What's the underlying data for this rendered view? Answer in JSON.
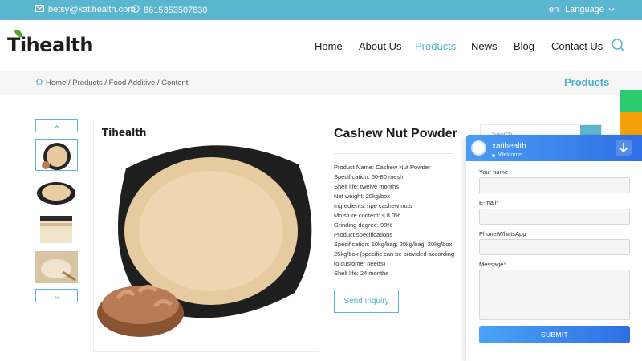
{
  "topbar": {
    "email": "betsy@xatihealth.com",
    "phone": "8615353507830",
    "lang_code": "en",
    "lang_label": "Language"
  },
  "header": {
    "logo": "Tihealth",
    "nav": [
      "Home",
      "About Us",
      "Products",
      "News",
      "Blog",
      "Contact Us"
    ],
    "active_nav": "Products"
  },
  "breadcrumb": {
    "path": "Home / Products / Food Additive / Content",
    "title": "Products"
  },
  "product": {
    "brand": "Tihealth",
    "title": "Cashew Nut Powder",
    "specs": [
      "Product Name: Cashew Nut Powder",
      "Specification: 60-80 mesh",
      "Shelf life: twelve months",
      "Net weight: 20kg/box",
      "Ingredients: ripe cashew nuts",
      "Moisture content: ≤ 8.0%",
      "Grinding degree: 98%",
      "Product specifications",
      "Specification: 10kg/bag; 20kg/bag; 20kg/box; 25kg/box (specific can be provided according to customer needs)",
      "Shelf life: 24 months"
    ],
    "inquiry_label": "Send Inquiry"
  },
  "sidebar": {
    "search_placeholder": "Search"
  },
  "chat": {
    "name": "xatihealth",
    "status": "Welcome",
    "labels": {
      "name": "Your name",
      "email": "E-mail",
      "phone": "Phone/WhatsApp",
      "message": "Message"
    },
    "submit_label": "SUBMIT"
  },
  "colors": {
    "topbar": "#5ab6cf",
    "accent": "#4fb3cc",
    "chat_blue": "#2f6fe5",
    "tab_green": "#2ecc71",
    "tab_orange": "#f5a00a"
  },
  "icons": [
    "mail-icon",
    "whatsapp-icon",
    "chevron-down-icon",
    "search-icon",
    "home-icon",
    "chevron-up-icon",
    "arrow-down-icon"
  ]
}
